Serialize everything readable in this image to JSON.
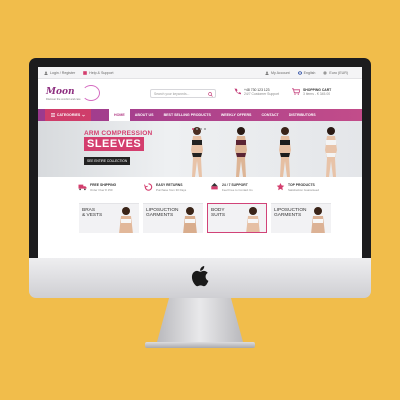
{
  "topbar": {
    "login": "Login / Register",
    "help": "Help & Support",
    "account": "My Account",
    "language": "English",
    "currency": "Euro (EUR)"
  },
  "header": {
    "logo": "Moon",
    "tagline": "Discover the comfort and care",
    "search_placeholder": "Search your keywords...",
    "phone_number": "+48 730 123 123",
    "phone_sub": "24/7 Customer Support",
    "cart_title": "SHOPPING CART",
    "cart_summary": "3 items - € 345.00"
  },
  "nav": {
    "categories": "CATEGORIES",
    "items": [
      "HOME",
      "ABOUT US",
      "BEST SELLING PRODUCTS",
      "WEEKLY OFFERS",
      "CONTACT",
      "DISTRIBUTORS"
    ],
    "active": "HOME"
  },
  "hero": {
    "title_line1": "ARM COMPRESSION",
    "title_line2": "SLEEVES",
    "button": "SEE ENTIRE COLLECTION",
    "slides": 4,
    "active_slide": 1
  },
  "features": [
    {
      "icon": "truck-icon",
      "title": "FREE SHIPPING",
      "sub": "Order Over € 150"
    },
    {
      "icon": "return-icon",
      "title": "EASY RETURNS",
      "sub": "Purchase from 30 Days"
    },
    {
      "icon": "support-icon",
      "title": "24 / 7 SUPPORT",
      "sub": "Feel Free to Contact Us"
    },
    {
      "icon": "star-icon",
      "title": "TOP PRODUCTS",
      "sub": "Satisfaction Guaranteed"
    }
  ],
  "tiles": [
    {
      "label": "BRAS\n& VESTS"
    },
    {
      "label": "LIPOSUCTION\nGARMENTS"
    },
    {
      "label": "BODY\nSUITS"
    },
    {
      "label": "LIPOSUCTION\nGARMENTS"
    }
  ],
  "colors": {
    "background": "#f1bd4b",
    "accent_pink": "#d43e6e",
    "nav_purple": "#9b3a8e",
    "bezel": "#1c1c1e"
  }
}
